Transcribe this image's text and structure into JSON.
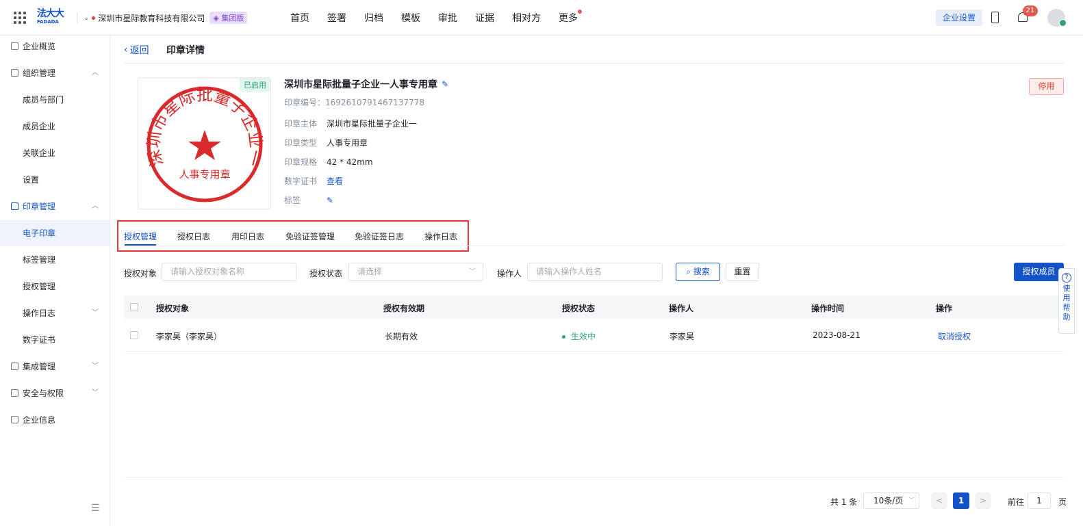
{
  "topbar": {
    "logo_main": "法大大",
    "logo_sub": "FADADA",
    "company": "深圳市星际教育科技有限公司",
    "edition": "集团版",
    "nav": [
      "首页",
      "签署",
      "归档",
      "模板",
      "审批",
      "证据",
      "相对方",
      "更多"
    ],
    "enterprise_settings": "企业设置",
    "notification_count": "21"
  },
  "sidebar": {
    "overview": "企业概览",
    "org": "组织管理",
    "org_children": [
      "成员与部门",
      "成员企业",
      "关联企业",
      "设置"
    ],
    "seal": "印章管理",
    "seal_children": [
      "电子印章",
      "标签管理",
      "授权管理",
      "操作日志",
      "数字证书"
    ],
    "integration": "集成管理",
    "security": "安全与权限",
    "info": "企业信息"
  },
  "header": {
    "back": "返回",
    "title": "印章详情"
  },
  "seal": {
    "status_tag": "已启用",
    "ring_text": "深圳市星际批量子企业一",
    "inner_text": "人事专用章",
    "name": "深圳市星际批量子企业一人事专用章",
    "number_label": "印章编号：",
    "number": "1692610791467137778",
    "owner_label": "印章主体",
    "owner": "深圳市星际批量子企业一",
    "type_label": "印章类型",
    "type": "人事专用章",
    "spec_label": "印章规格",
    "spec": "42 * 42mm",
    "cert_label": "数字证书",
    "cert_link": "查看",
    "tags_label": "标签",
    "disable": "停用"
  },
  "tabs": [
    "授权管理",
    "授权日志",
    "用印日志",
    "免验证签管理",
    "免验证签日志",
    "操作日志"
  ],
  "filters": {
    "target_label": "授权对象",
    "target_placeholder": "请输入授权对象名称",
    "status_label": "授权状态",
    "status_placeholder": "请选择",
    "operator_label": "操作人",
    "operator_placeholder": "请输入操作人姓名",
    "search": "搜索",
    "reset": "重置",
    "authorize": "授权成员"
  },
  "table": {
    "columns": [
      "授权对象",
      "授权有效期",
      "授权状态",
      "操作人",
      "操作时间",
      "操作"
    ],
    "rows": [
      {
        "target": "李家昊（李家昊）",
        "validity": "长期有效",
        "status": "生效中",
        "operator": "李家昊",
        "time": "2023-08-21",
        "action": "取消授权"
      }
    ]
  },
  "pagination": {
    "total": "共 1 条",
    "page_size": "10条/页",
    "prev": "<",
    "current": "1",
    "next": ">",
    "goto_label": "前往",
    "goto_value": "1",
    "page_unit": "页"
  },
  "help": {
    "text": "使用帮助"
  },
  "colors": {
    "primary": "#1352c7",
    "success": "#2ba471",
    "danger": "#d4442f",
    "seal_red": "#d92b2b"
  }
}
